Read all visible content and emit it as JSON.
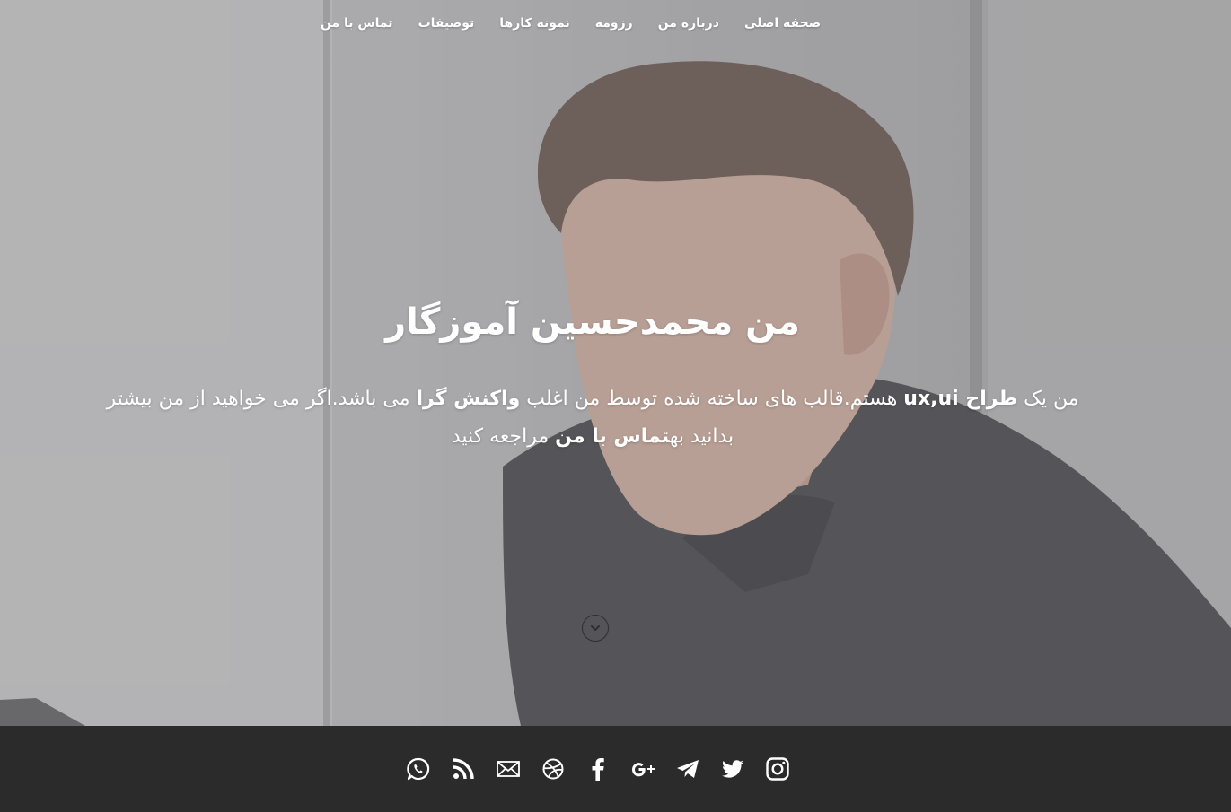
{
  "nav": {
    "items": [
      {
        "label": "صحفه اصلی"
      },
      {
        "label": "درباره من"
      },
      {
        "label": "رزومه"
      },
      {
        "label": "نمونه کارها"
      },
      {
        "label": "توصیفات"
      },
      {
        "label": "تماس با من"
      }
    ]
  },
  "hero": {
    "title": "من محمدحسین آموزگار",
    "intro": {
      "t1": "من یک ",
      "b1": "طراح ux,ui",
      "t2": " هستم.قالب های ساخته شده توسط من اغلب ",
      "b2": "واکنش گرا",
      "t3": " می باشد.اگر می خواهید از من بیشتر بدانید به",
      "b3": "تماس با من",
      "t4": " مراجعه کنید"
    }
  },
  "scroll_icon": "chevron-down-icon",
  "social": [
    "whatsapp-icon",
    "rss-icon",
    "email-icon",
    "dribbble-icon",
    "facebook-icon",
    "google-plus-icon",
    "telegram-icon",
    "twitter-icon",
    "instagram-icon"
  ],
  "colors": {
    "footer_bg": "#2b2b2b",
    "text": "#ffffff",
    "icon": "#ffffff"
  }
}
